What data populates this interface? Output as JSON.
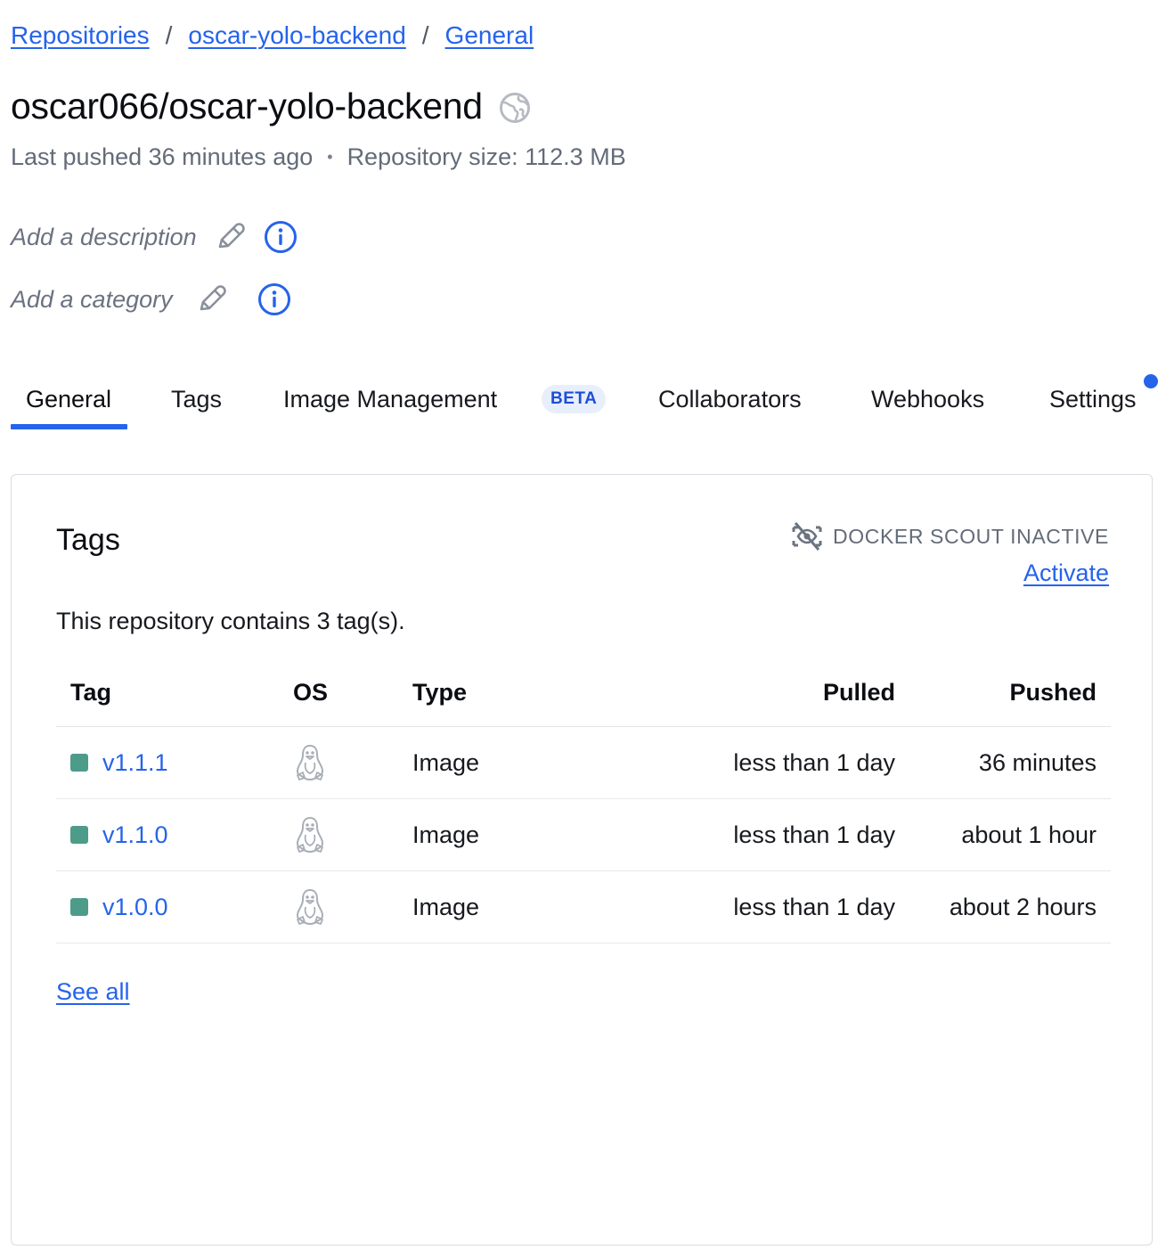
{
  "breadcrumb": {
    "items": [
      "Repositories",
      "oscar-yolo-backend",
      "General"
    ],
    "separator": "/"
  },
  "repo": {
    "title": "oscar066/oscar-yolo-backend",
    "visibility_icon": "globe-icon",
    "last_pushed": "Last pushed 36 minutes ago",
    "separator_dot": "•",
    "size": "Repository size: 112.3 MB",
    "add_description": "Add a description",
    "add_category": "Add a category"
  },
  "tabs": {
    "general": "General",
    "tags": "Tags",
    "image_management": "Image Management",
    "beta_badge": "BETA",
    "collaborators": "Collaborators",
    "webhooks": "Webhooks",
    "settings": "Settings"
  },
  "card": {
    "title": "Tags",
    "scout_status": "DOCKER SCOUT INACTIVE",
    "activate": "Activate",
    "summary": "This repository contains 3 tag(s).",
    "see_all": "See all",
    "columns": {
      "tag": "Tag",
      "os": "OS",
      "type": "Type",
      "pulled": "Pulled",
      "pushed": "Pushed"
    },
    "rows": [
      {
        "tag": "v1.1.1",
        "os_icon": "linux-icon",
        "type": "Image",
        "pulled": "less than 1 day",
        "pushed": "36 minutes"
      },
      {
        "tag": "v1.1.0",
        "os_icon": "linux-icon",
        "type": "Image",
        "pulled": "less than 1 day",
        "pushed": "about 1 hour"
      },
      {
        "tag": "v1.0.0",
        "os_icon": "linux-icon",
        "type": "Image",
        "pulled": "less than 1 day",
        "pushed": "about 2 hours"
      }
    ]
  },
  "colors": {
    "accent": "#2563eb",
    "tag_status": "#4d9c8a",
    "muted_text": "#636b78"
  }
}
